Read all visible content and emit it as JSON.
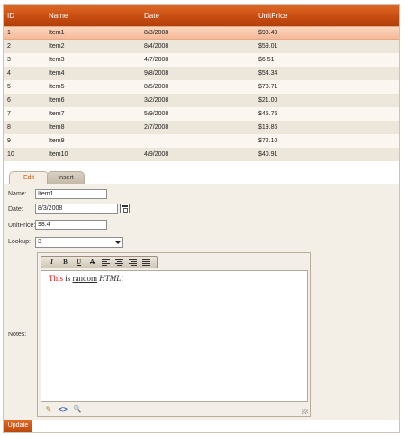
{
  "grid": {
    "columns": [
      "ID",
      "Name",
      "Date",
      "UnitPrice"
    ],
    "rows": [
      {
        "id": "1",
        "name": "Item1",
        "date": "8/3/2008",
        "price": "$98.40"
      },
      {
        "id": "2",
        "name": "Item2",
        "date": "8/4/2008",
        "price": "$59.01"
      },
      {
        "id": "3",
        "name": "Item3",
        "date": "4/7/2008",
        "price": "$6.51"
      },
      {
        "id": "4",
        "name": "Item4",
        "date": "9/8/2008",
        "price": "$54.34"
      },
      {
        "id": "5",
        "name": "Item5",
        "date": "8/5/2008",
        "price": "$78.71"
      },
      {
        "id": "6",
        "name": "Item6",
        "date": "3/2/2008",
        "price": "$21.00"
      },
      {
        "id": "7",
        "name": "Item7",
        "date": "5/9/2008",
        "price": "$45.76"
      },
      {
        "id": "8",
        "name": "Item8",
        "date": "2/7/2008",
        "price": "$19.86"
      },
      {
        "id": "9",
        "name": "Item9",
        "date": "",
        "price": "$72.10"
      },
      {
        "id": "10",
        "name": "Item10",
        "date": "4/9/2008",
        "price": "$40.91"
      }
    ],
    "selected_row": "1"
  },
  "tabs": {
    "edit": "Edit",
    "insert": "Insert",
    "active": "Edit"
  },
  "form": {
    "name_label": "Name:",
    "name_value": "Item1",
    "date_label": "Date:",
    "date_value": "8/3/2008",
    "price_label": "UnitPrice:",
    "price_value": "98.4",
    "lookup_label": "Lookup:",
    "lookup_value": "3",
    "notes_label": "Notes:",
    "notes_words": [
      "This",
      "is",
      "random",
      "HTML",
      "!"
    ]
  },
  "toolbar": {
    "italic": "I",
    "bold": "B",
    "underline": "U",
    "strike": "A",
    "icons": [
      "italic-icon",
      "bold-icon",
      "underline-icon",
      "strikethrough-icon",
      "align-left-icon",
      "align-center-icon",
      "align-right-icon",
      "justify-icon"
    ]
  },
  "modes": {
    "design": "✎",
    "html": "<>",
    "preview": "🔍"
  },
  "update_label": "Update",
  "colors": {
    "header": "#c84d12",
    "selected": "#f6b999",
    "accent": "#c25513"
  }
}
